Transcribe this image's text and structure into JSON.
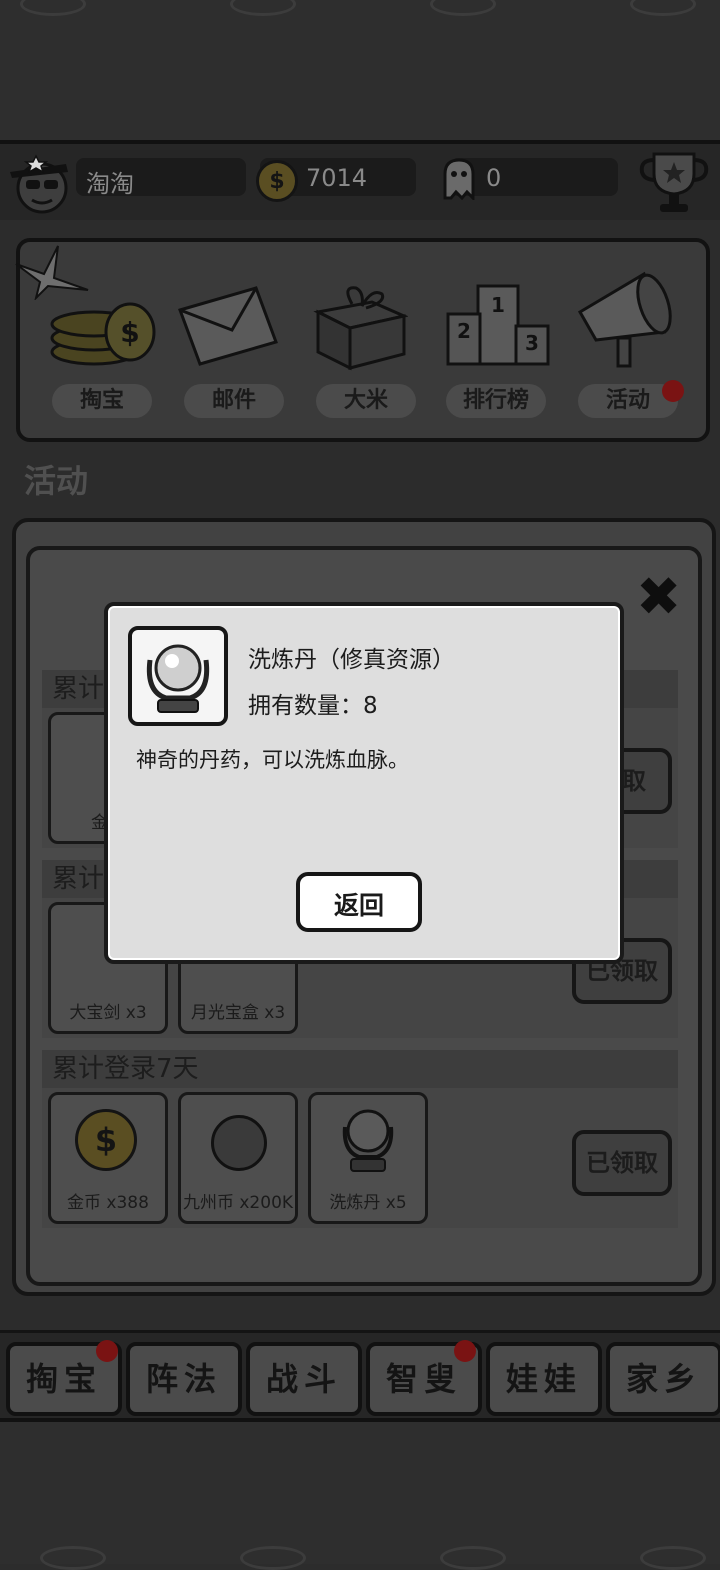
{
  "player": {
    "name": "淘淘",
    "coins": "7014",
    "ghosts": "0"
  },
  "menu": [
    {
      "label": "掏宝",
      "icon": "coin-stack-icon"
    },
    {
      "label": "邮件",
      "icon": "envelope-icon"
    },
    {
      "label": "大米",
      "icon": "gift-box-icon"
    },
    {
      "label": "排行榜",
      "icon": "podium-icon"
    },
    {
      "label": "活动",
      "icon": "megaphone-icon",
      "badge": true
    }
  ],
  "section_title": "活动",
  "activity": {
    "rows": [
      {
        "title": "累计",
        "rewards": [
          {
            "label": "金币"
          }
        ],
        "claim": "领取"
      },
      {
        "title": "累计",
        "rewards": [
          {
            "label": "大宝剑 x3"
          },
          {
            "label": "月光宝盒 x3"
          }
        ],
        "claim": "已领取"
      },
      {
        "title": "累计登录7天",
        "rewards": [
          {
            "label": "金币 x388"
          },
          {
            "label": "九州币 x200K"
          },
          {
            "label": "洗炼丹 x5"
          }
        ],
        "claim": "已领取"
      }
    ]
  },
  "tabs": [
    {
      "label": "掏宝",
      "badge": true
    },
    {
      "label": "阵法",
      "badge": false
    },
    {
      "label": "战斗",
      "badge": false
    },
    {
      "label": "智叟",
      "badge": true
    },
    {
      "label": "娃娃",
      "badge": false
    },
    {
      "label": "家乡",
      "badge": false
    }
  ],
  "dialog": {
    "item_name": "洗炼丹（修真资源）",
    "count_text": "拥有数量：8",
    "description": "神奇的丹药，可以洗炼血脉。",
    "back_button": "返回",
    "icon": "crystal-ball-icon"
  },
  "colors": {
    "badge": "#7a1313",
    "dialog_bg": "#dedede",
    "overlay": "#2c2c2c"
  }
}
